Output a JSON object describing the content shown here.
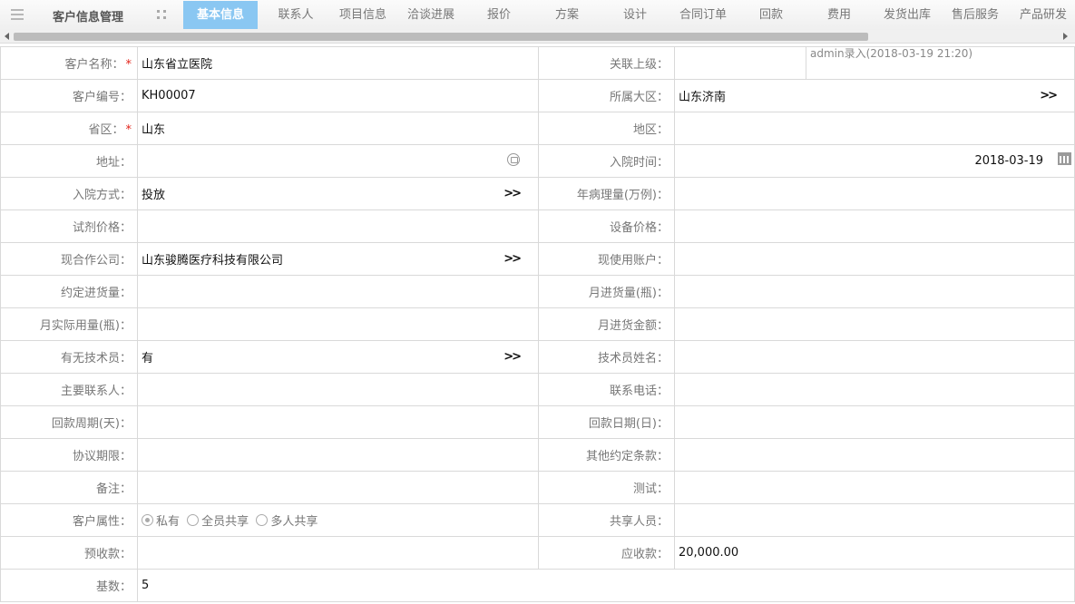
{
  "header": {
    "app_title": "客户信息管理",
    "tabs": [
      "基本信息",
      "联系人",
      "项目信息",
      "洽谈进展",
      "报价",
      "方案",
      "设计",
      "合同订单",
      "回款",
      "费用",
      "发货出库",
      "售后服务",
      "产品研发"
    ],
    "active_tab": "基本信息"
  },
  "audit": "admin录入(2018-03-19 21:20)",
  "fields": {
    "customer_name": {
      "label": "客户名称：",
      "value": "山东省立医院",
      "required": "*"
    },
    "parent": {
      "label": "关联上级："
    },
    "customer_no": {
      "label": "客户编号：",
      "value": "KH00007"
    },
    "big_region": {
      "label": "所属大区：",
      "value": "山东济南"
    },
    "province": {
      "label": "省区：",
      "value": "山东",
      "required": "*"
    },
    "area": {
      "label": "地区："
    },
    "address": {
      "label": "地址："
    },
    "entry_date": {
      "label": "入院时间：",
      "value": "2018-03-19"
    },
    "entry_method": {
      "label": "入院方式：",
      "value": "投放"
    },
    "annual_cases": {
      "label": "年病理量(万例)："
    },
    "reagent_price": {
      "label": "试剂价格："
    },
    "equipment_price": {
      "label": "设备价格："
    },
    "partner": {
      "label": "现合作公司：",
      "value": "山东骏腾医疗科技有限公司"
    },
    "account": {
      "label": "现使用账户："
    },
    "agreed_purchase": {
      "label": "约定进货量："
    },
    "monthly_purchase_qty": {
      "label": "月进货量(瓶)："
    },
    "monthly_actual_usage": {
      "label": "月实际用量(瓶)："
    },
    "monthly_purchase_amount": {
      "label": "月进货金额："
    },
    "has_technician": {
      "label": "有无技术员：",
      "value": "有"
    },
    "technician_name": {
      "label": "技术员姓名："
    },
    "main_contact": {
      "label": "主要联系人："
    },
    "phone": {
      "label": "联系电话："
    },
    "payment_cycle": {
      "label": "回款周期(天)："
    },
    "payment_day": {
      "label": "回款日期(日)："
    },
    "agreement_term": {
      "label": "协议期限："
    },
    "other_terms": {
      "label": "其他约定条款："
    },
    "remark": {
      "label": "备注："
    },
    "test": {
      "label": "测试："
    },
    "customer_attr": {
      "label": "客户属性：",
      "options": [
        "私有",
        "全员共享",
        "多人共享"
      ],
      "selected": "私有"
    },
    "shared_people": {
      "label": "共享人员："
    },
    "advance_receipt": {
      "label": "预收款："
    },
    "receivable": {
      "label": "应收款：",
      "value": "20,000.00"
    },
    "base_count": {
      "label": "基数：",
      "value": "5"
    }
  }
}
